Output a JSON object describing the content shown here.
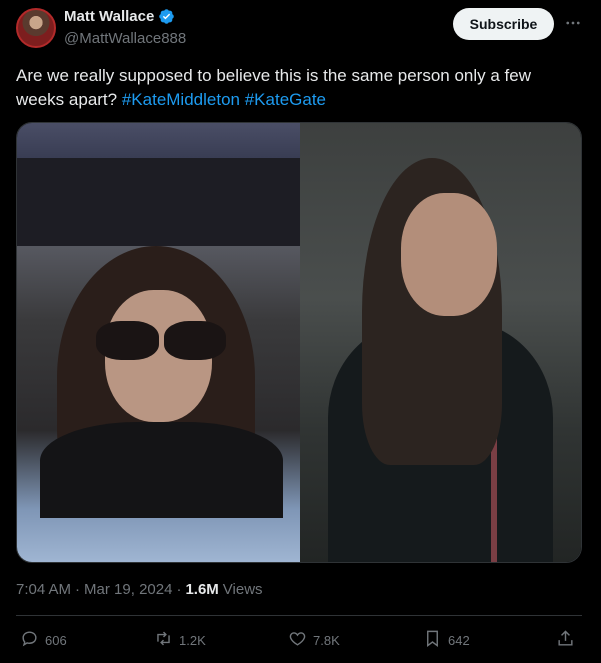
{
  "author": {
    "display_name": "Matt Wallace",
    "handle": "@MattWallace888",
    "verified_badge_color": "#1d9bf0"
  },
  "header": {
    "subscribe_label": "Subscribe",
    "more_icon": "more-horizontal-icon"
  },
  "tweet": {
    "text": "Are we really supposed to believe this is the same person only a few weeks apart? ",
    "hashtags": [
      "#KateMiddleton",
      "#KateGate"
    ]
  },
  "media": {
    "photos": [
      {
        "kind": "left-photo"
      },
      {
        "kind": "right-photo"
      }
    ]
  },
  "meta": {
    "time": "7:04 AM",
    "separator": "·",
    "date": "Mar 19, 2024",
    "views_count": "1.6M",
    "views_label": "Views"
  },
  "actions": {
    "replies": {
      "icon": "reply-icon",
      "count": "606"
    },
    "reposts": {
      "icon": "repost-icon",
      "count": "1.2K"
    },
    "likes": {
      "icon": "heart-icon",
      "count": "7.8K"
    },
    "bookmarks": {
      "icon": "bookmark-icon",
      "count": "642"
    },
    "share": {
      "icon": "share-icon"
    }
  },
  "colors": {
    "background": "#000000",
    "text_primary": "#e7e9ea",
    "text_secondary": "#71767b",
    "accent": "#1d9bf0",
    "divider": "#2f3336"
  }
}
